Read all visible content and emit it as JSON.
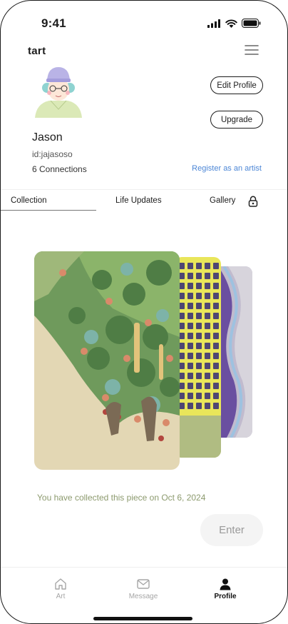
{
  "status_bar": {
    "time": "9:41"
  },
  "header": {
    "brand": "tart"
  },
  "profile": {
    "name": "Jason",
    "user_id": "id:jajasoso",
    "connections": "6 Connections",
    "edit_label": "Edit Profile",
    "upgrade_label": "Upgrade",
    "register_link": "Register as an artist"
  },
  "tabs": [
    {
      "label": "Collection",
      "active": true
    },
    {
      "label": "Life Updates",
      "active": false
    },
    {
      "label": "Gallery",
      "active": false,
      "locked": true
    }
  ],
  "collection": {
    "cards": [
      {
        "subject": "garden-painting"
      },
      {
        "subject": "yellow-grid-painting"
      },
      {
        "subject": "purple-wave-painting"
      }
    ],
    "note": "You have collected this piece on Oct 6, 2024",
    "enter_label": "Enter"
  },
  "bottom_nav": [
    {
      "label": "Art",
      "icon": "home-icon",
      "active": false
    },
    {
      "label": "Message",
      "icon": "mail-icon",
      "active": false
    },
    {
      "label": "Profile",
      "icon": "person-icon",
      "active": true
    }
  ],
  "colors": {
    "accent_link": "#4c86d6",
    "note_text": "#8c9a6e",
    "enter_bg": "#f4f4f4"
  }
}
